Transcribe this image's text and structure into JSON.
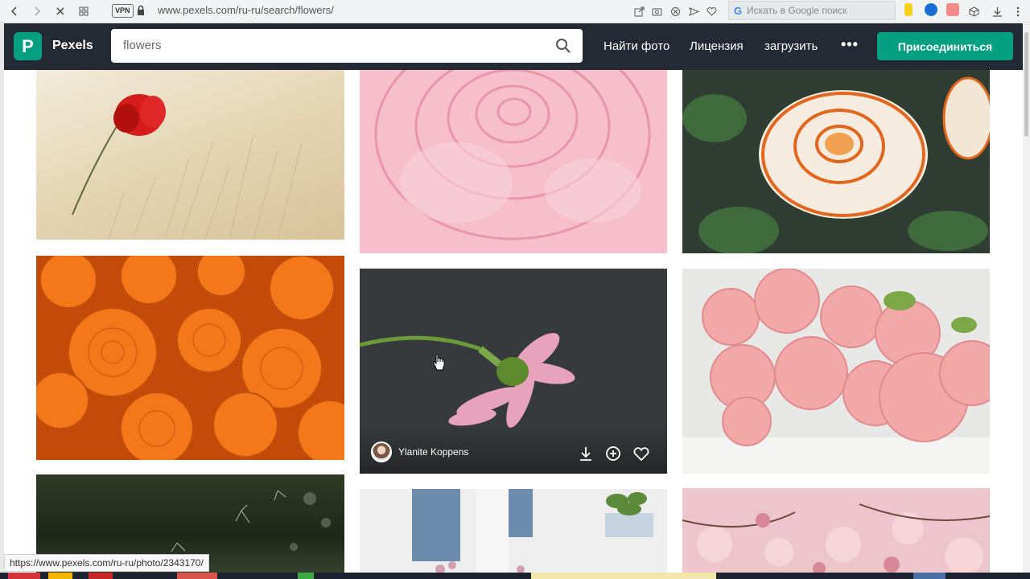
{
  "browser": {
    "vpn_label": "VPN",
    "url": "www.pexels.com/ru-ru/search/flowers/",
    "google_placeholder": "Искать в Google поиск",
    "google_letter": "G"
  },
  "header": {
    "brand": "Pexels",
    "logo_letter": "P",
    "search_value": "flowers",
    "nav": [
      "Найти фото",
      "Лицензия",
      "загрузить"
    ],
    "more_label": "•••",
    "join_label": "Присоединиться"
  },
  "photos": [
    {
      "subject": "red poppy in wheat field"
    },
    {
      "subject": "pink rose close-up"
    },
    {
      "subject": "white orange-edged roses"
    },
    {
      "subject": "orange roses bouquet"
    },
    {
      "subject": "pink gerbera on dark background",
      "author": "Ylanite Koppens"
    },
    {
      "subject": "pink roses on table"
    },
    {
      "subject": "dandelion seeds dark"
    },
    {
      "subject": "person in blue sweater with flowers"
    },
    {
      "subject": "pink blossoms"
    }
  ],
  "status_url": "https://www.pexels.com/ru-ru/photo/2343170/",
  "colors": {
    "brand_green": "#05a081",
    "header_bg": "#232a34"
  }
}
